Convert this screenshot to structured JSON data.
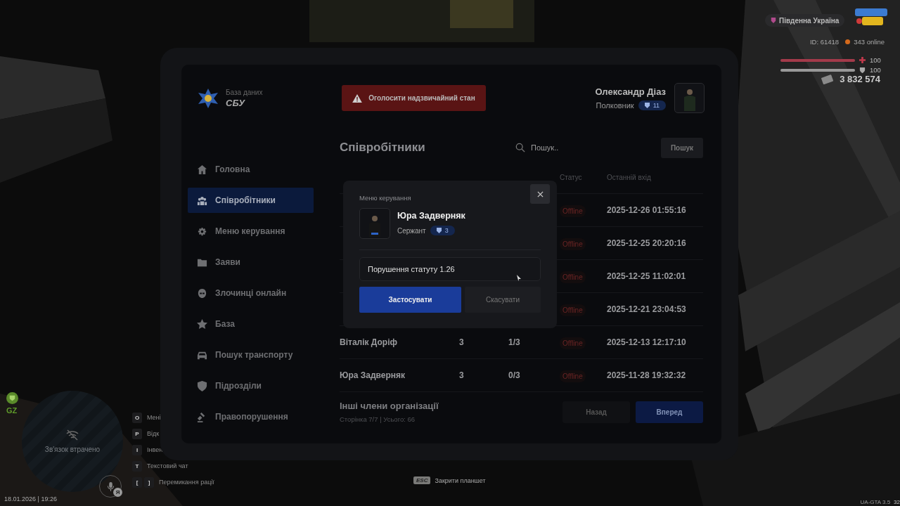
{
  "hud": {
    "server": "Південна Україна",
    "player_id": "ID: 61418",
    "online": "343 online",
    "health": {
      "level": 1,
      "reading": "100"
    },
    "armor": {
      "level": 1,
      "reading": "100"
    },
    "money": "3 832 574",
    "zone": "GZ",
    "minimap_text": "Зв'язок втрачено",
    "voice_badge": "Я",
    "key_hints": [
      {
        "keys": [
          "O"
        ],
        "label": "Мені"
      },
      {
        "keys": [
          "P"
        ],
        "label": "Відк"
      },
      {
        "keys": [
          "I"
        ],
        "label": "Інвен"
      },
      {
        "keys": [
          "T"
        ],
        "label": "Текстовий чат"
      },
      {
        "keys": [
          "[",
          "]"
        ],
        "label": "Перемикання рації"
      }
    ],
    "datetime": "18.01.2026 | 19:26",
    "esc_key": "ESC",
    "esc_label": "Закрити планшет",
    "build": "UA-GTA 3.5",
    "build_extra": "32"
  },
  "tablet": {
    "app_subtitle": "База даних",
    "app_title": "СБУ",
    "alert_button": "Оголосити надзвичайний стан",
    "user": {
      "name": "Олександр Діаз",
      "rank": "Полковник",
      "rank_level": "11"
    },
    "sidebar": [
      {
        "label": "Головна",
        "selected": false
      },
      {
        "label": "Співробітники",
        "selected": true
      },
      {
        "label": "Меню керування",
        "selected": false
      },
      {
        "label": "Заяви",
        "selected": false
      },
      {
        "label": "Злочинці онлайн",
        "selected": false
      },
      {
        "label": "База",
        "selected": false
      },
      {
        "label": "Пошук транспорту",
        "selected": false
      },
      {
        "label": "Підрозділи",
        "selected": false
      },
      {
        "label": "Правопорушення",
        "selected": false
      }
    ],
    "page_title": "Співробітники",
    "search": {
      "placeholder": "Пошук.."
    },
    "search_button": "Пошук",
    "columns": [
      "Статус",
      "Останній вхід"
    ],
    "rows": [
      {
        "status": "Offline",
        "last_login": "2025-12-26 01:55:16"
      },
      {
        "status": "Offline",
        "last_login": "2025-12-25 20:20:16"
      },
      {
        "status": "Offline",
        "last_login": "2025-12-25 11:02:01"
      },
      {
        "status": "Offline",
        "last_login": "2025-12-21 23:04:53"
      },
      {
        "name": "Віталік Доріф",
        "rank": "3",
        "warnings": "1/3",
        "status": "Offline",
        "last_login": "2025-12-13 12:17:10"
      },
      {
        "name": "Юра Задверняк",
        "rank": "3",
        "warnings": "0/3",
        "status": "Offline",
        "last_login": "2025-11-28 19:32:32"
      }
    ],
    "footer_title": "Інші члени організації",
    "footer_subtitle": "Сторінка 7/7 | Усього: 66",
    "prev_button": "Назад",
    "next_button": "Вперед"
  },
  "dialog": {
    "title": "Меню керування",
    "name": "Юра Задверняк",
    "rank": "Сержант",
    "rank_level": "3",
    "reason": "Порушення статуту 1.26",
    "apply_button": "Застосувати",
    "cancel_button": "Скасувати"
  }
}
